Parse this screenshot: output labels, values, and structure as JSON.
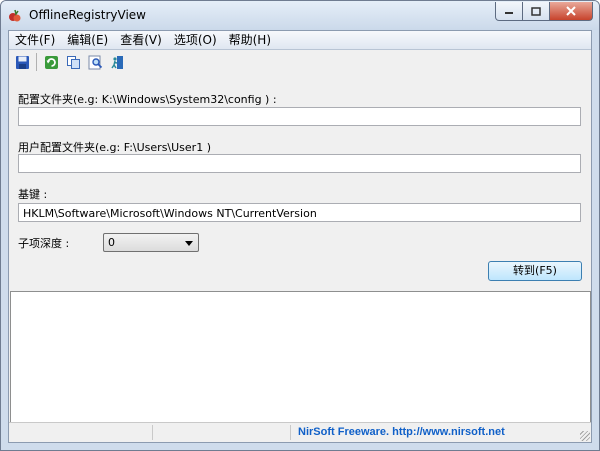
{
  "window": {
    "title": "OfflineRegistryView"
  },
  "menu": [
    "文件(F)",
    "编辑(E)",
    "查看(V)",
    "选项(O)",
    "帮助(H)"
  ],
  "toolbar": {
    "icons": [
      "save-icon",
      "refresh-icon",
      "copy-icon",
      "find-icon",
      "exit-icon"
    ]
  },
  "form": {
    "config_folder_label": "配置文件夹(e.g: K:\\Windows\\System32\\config ) :",
    "config_folder_value": "",
    "user_profile_label": "用户配置文件夹(e.g: F:\\Users\\User1 )",
    "user_profile_value": "",
    "base_key_label": "基键 :",
    "base_key_value": "HKLM\\Software\\Microsoft\\Windows NT\\CurrentVersion",
    "subkey_depth_label": "子项深度 :",
    "subkey_depth_value": "0",
    "goto_button": "转到(F5)"
  },
  "status": {
    "link_text": "NirSoft Freeware.  http://www.nirsoft.net"
  }
}
